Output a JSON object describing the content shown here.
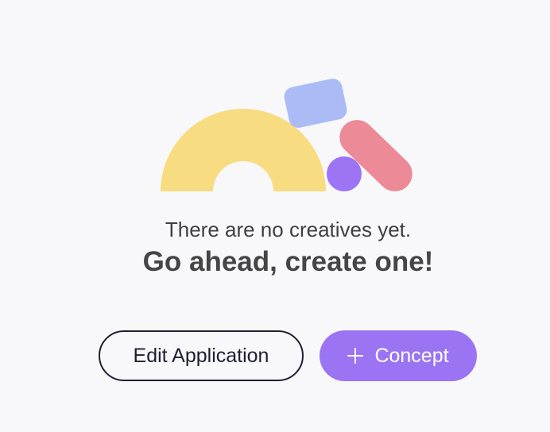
{
  "empty_state": {
    "message": "There are no creatives yet.",
    "call_to_action": "Go ahead, create one!"
  },
  "actions": {
    "edit_application_label": "Edit Application",
    "concept_label": "Concept",
    "concept_icon": "plus-icon"
  },
  "illustration": {
    "colors": {
      "arch": "#f7dc82",
      "diamond": "#aabbf6",
      "pill": "#ec8a98",
      "circle": "#9d74f4"
    }
  },
  "colors": {
    "background": "#f8f8fb",
    "primary_button": "#9b74f3",
    "outline_button": "#1f1f33",
    "text": "#3f3f3f"
  }
}
